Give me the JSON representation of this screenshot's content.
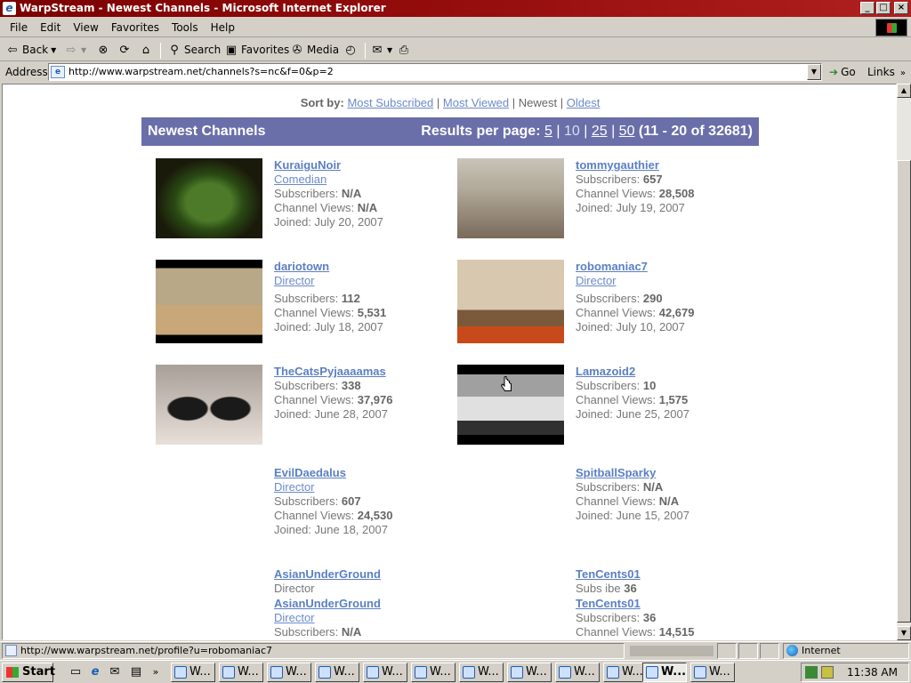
{
  "window": {
    "title": "WarpStream - Newest Channels - Microsoft Internet Explorer",
    "buttons": {
      "minimize": "_",
      "maximize": "□",
      "close": "×"
    }
  },
  "menu": [
    "File",
    "Edit",
    "View",
    "Favorites",
    "Tools",
    "Help"
  ],
  "toolbar": {
    "back": "Back",
    "search": "Search",
    "favorites": "Favorites",
    "media": "Media"
  },
  "address": {
    "label": "Address",
    "url": "http://www.warpstream.net/channels?s=nc&f=0&p=2",
    "go": "Go",
    "links": "Links"
  },
  "page": {
    "sort": {
      "label": "Sort by:",
      "options": [
        "Most Subscribed",
        "Most Viewed",
        "Newest",
        "Oldest"
      ],
      "current": "Newest",
      "separator": "|"
    },
    "header": {
      "title": "Newest Channels",
      "rpp_label": "Results per page:",
      "rpp_options": [
        "5",
        "10",
        "25",
        "50"
      ],
      "rpp_current": "10",
      "range": "(11 - 20 of 32681)"
    },
    "labels": {
      "subscribers": "Subscribers:",
      "views": "Channel Views:",
      "joined": "Joined:"
    },
    "channels": [
      {
        "name": "KuraiguNoir",
        "category": "Comedian",
        "subscribers": "N/A",
        "views": "N/A",
        "joined": "July 20, 2007",
        "thumb": "green-monster-cartoon"
      },
      {
        "name": "tommygauthier",
        "category": "",
        "subscribers": "657",
        "views": "28,508",
        "joined": "July 19, 2007",
        "thumb": "guitar-players"
      },
      {
        "name": "dariotown",
        "category": "Director",
        "subscribers": "112",
        "views": "5,531",
        "joined": "July 18, 2007",
        "thumb": "jeep-desert"
      },
      {
        "name": "robomaniac7",
        "category": "Director",
        "subscribers": "290",
        "views": "42,679",
        "joined": "July 10, 2007",
        "thumb": "lego-robot"
      },
      {
        "name": "TheCatsPyjaaaamas",
        "category": "",
        "subscribers": "338",
        "views": "37,976",
        "joined": "June 28, 2007",
        "thumb": "two-cats"
      },
      {
        "name": "Lamazoid2",
        "category": "",
        "subscribers": "10",
        "views": "1,575",
        "joined": "June 25, 2007",
        "thumb": "car"
      },
      {
        "name": "EvilDaedalus",
        "category": "Director",
        "subscribers": "607",
        "views": "24,530",
        "joined": "June 18, 2007",
        "thumb": ""
      },
      {
        "name": "SpitballSparky",
        "category": "",
        "subscribers": "N/A",
        "views": "N/A",
        "joined": "June 15, 2007",
        "thumb": ""
      }
    ],
    "partial_left": {
      "name_a": "AsianUnderGround",
      "category_a": "Director",
      "name_b": "AsianUnderGround",
      "category_b": "Director",
      "subscribers": "N/A"
    },
    "partial_right": {
      "name_a": "TenCents01",
      "subs_garbled": "Subs   ibe",
      "subs_val": "36",
      "name_b": "TenCents01",
      "subscribers": "36",
      "views": "14,515"
    }
  },
  "statusbar": {
    "url": "http://www.warpstream.net/profile?u=robomaniac7",
    "zone": "Internet"
  },
  "taskbar": {
    "start": "Start",
    "task_label": "W...",
    "active_task_label": "W...",
    "time": "11:38 AM"
  }
}
